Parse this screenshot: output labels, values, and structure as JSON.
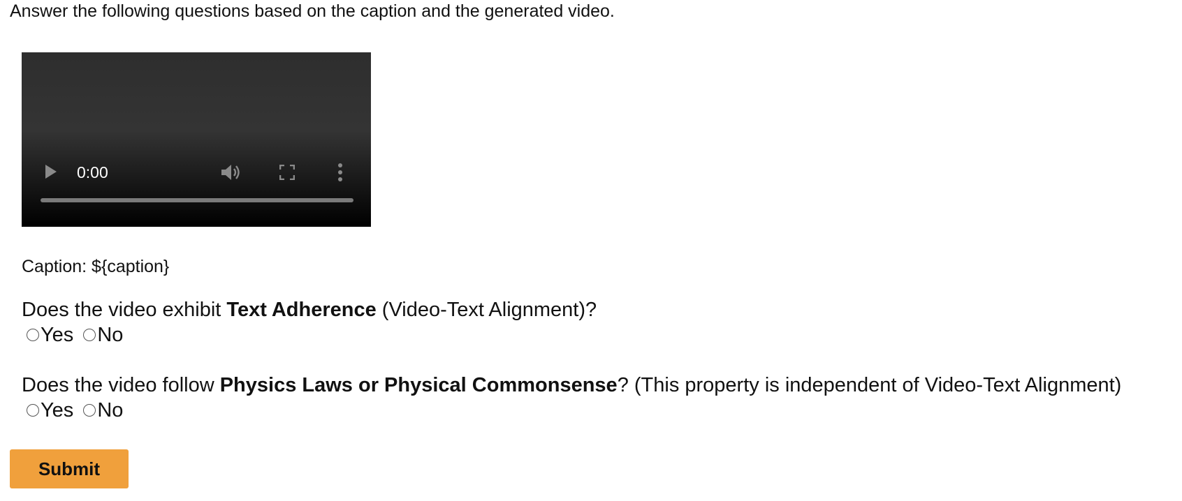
{
  "instructions": "Answer the following questions based on the caption and the generated video.",
  "video": {
    "time": "0:00",
    "progress": 0.0,
    "icons": {
      "play": "play-icon",
      "volume": "volume-icon",
      "fullscreen": "fullscreen-icon",
      "more": "more-vertical-icon"
    }
  },
  "caption": "Caption: ${caption}",
  "questions": [
    {
      "prefix": "Does the video exhibit ",
      "bold": "Text Adherence",
      "suffix": " (Video-Text Alignment)?",
      "options": [
        "Yes",
        "No"
      ]
    },
    {
      "prefix": "Does the video follow ",
      "bold": "Physics Laws or Physical Commonsense",
      "suffix": "? (This property is independent of Video-Text Alignment)",
      "options": [
        "Yes",
        "No"
      ]
    }
  ],
  "submit_label": "Submit",
  "colors": {
    "submit_bg": "#f0a03c",
    "video_bg": "#2e2e2e",
    "text": "#111111"
  }
}
